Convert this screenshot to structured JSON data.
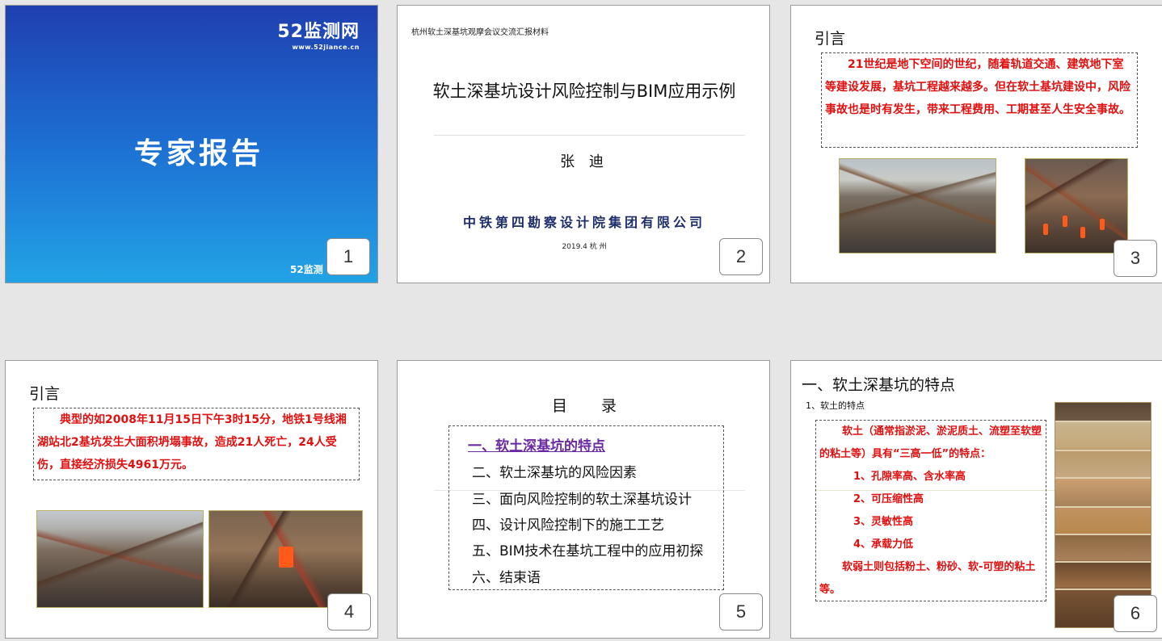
{
  "slides": [
    {
      "number": "1",
      "logo": "52监测网",
      "url": "www.52jiance.cn",
      "title": "专家报告",
      "footer": "52监测"
    },
    {
      "number": "2",
      "top_note": "杭州软土深基坑观摩会议交流汇报材料",
      "title": "软土深基坑设计风险控制与BIM应用示例",
      "author": "张 迪",
      "organization": "中铁第四勘察设计院集团有限公司",
      "date": "2019.4   杭 州"
    },
    {
      "number": "3",
      "heading": "引言",
      "text": "21世纪是地下空间的世纪，随着轨道交通、建筑地下室等建设发展，基坑工程越来越多。但在软土基坑建设中，风险事故也是时有发生，带来工程费用、工期甚至人生安全事故。"
    },
    {
      "number": "4",
      "heading": "引言",
      "text": "典型的如2008年11月15日下午3时15分，地铁1号线湘湖站北2基坑发生大面积坍塌事故，造成21人死亡，24人受伤，直接经济损失4961万元。"
    },
    {
      "number": "5",
      "title": "目 录",
      "items": [
        "一、软土深基坑的特点",
        "二、软土深基坑的风险因素",
        "三、面向风险控制的软土深基坑设计",
        "四、设计风险控制下的施工工艺",
        "五、BIM技术在基坑工程中的应用初探",
        "六、结束语"
      ]
    },
    {
      "number": "6",
      "heading": "一、软土深基坑的特点",
      "sub": "1、软土的特点",
      "intro": "软土（通常指淤泥、淤泥质土、流塑至软塑的粘土等）具有“三高一低”的特点：",
      "points": [
        "1、孔隙率高、含水率高",
        "2、可压缩性高",
        "3、灵敏性高",
        "4、承载力低"
      ],
      "outro": "软弱土则包括粉土、粉砂、软-可塑的粘土等。"
    }
  ]
}
